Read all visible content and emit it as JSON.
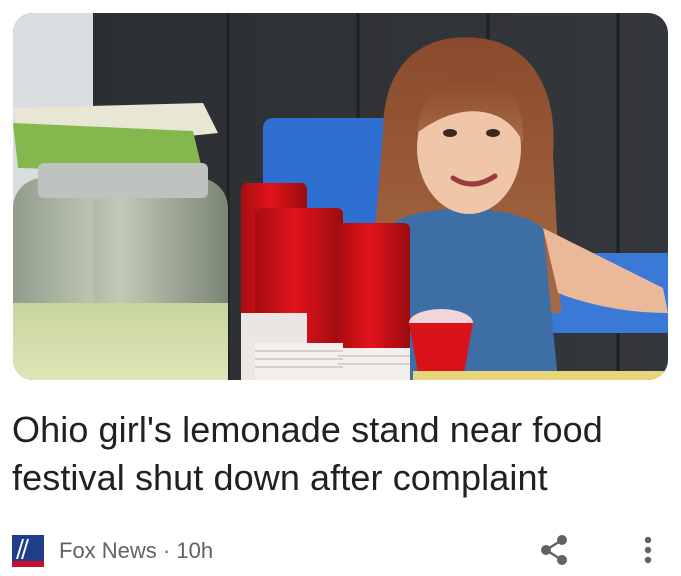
{
  "article": {
    "image_alt": "Girl at lemonade stand with red cups and glass jar",
    "headline": "Ohio girl's lemonade stand near food festival shut down after complaint",
    "source": "Fox News",
    "separator": "·",
    "age": "10h"
  },
  "icons": {
    "source_logo": "fox-news-logo",
    "share": "share-icon",
    "more": "more-vert-icon"
  },
  "colors": {
    "headline": "#202124",
    "meta_text": "#5f6368",
    "icon": "#5f6368",
    "logo_blue": "#1f3d8a",
    "logo_red": "#c8102e"
  }
}
